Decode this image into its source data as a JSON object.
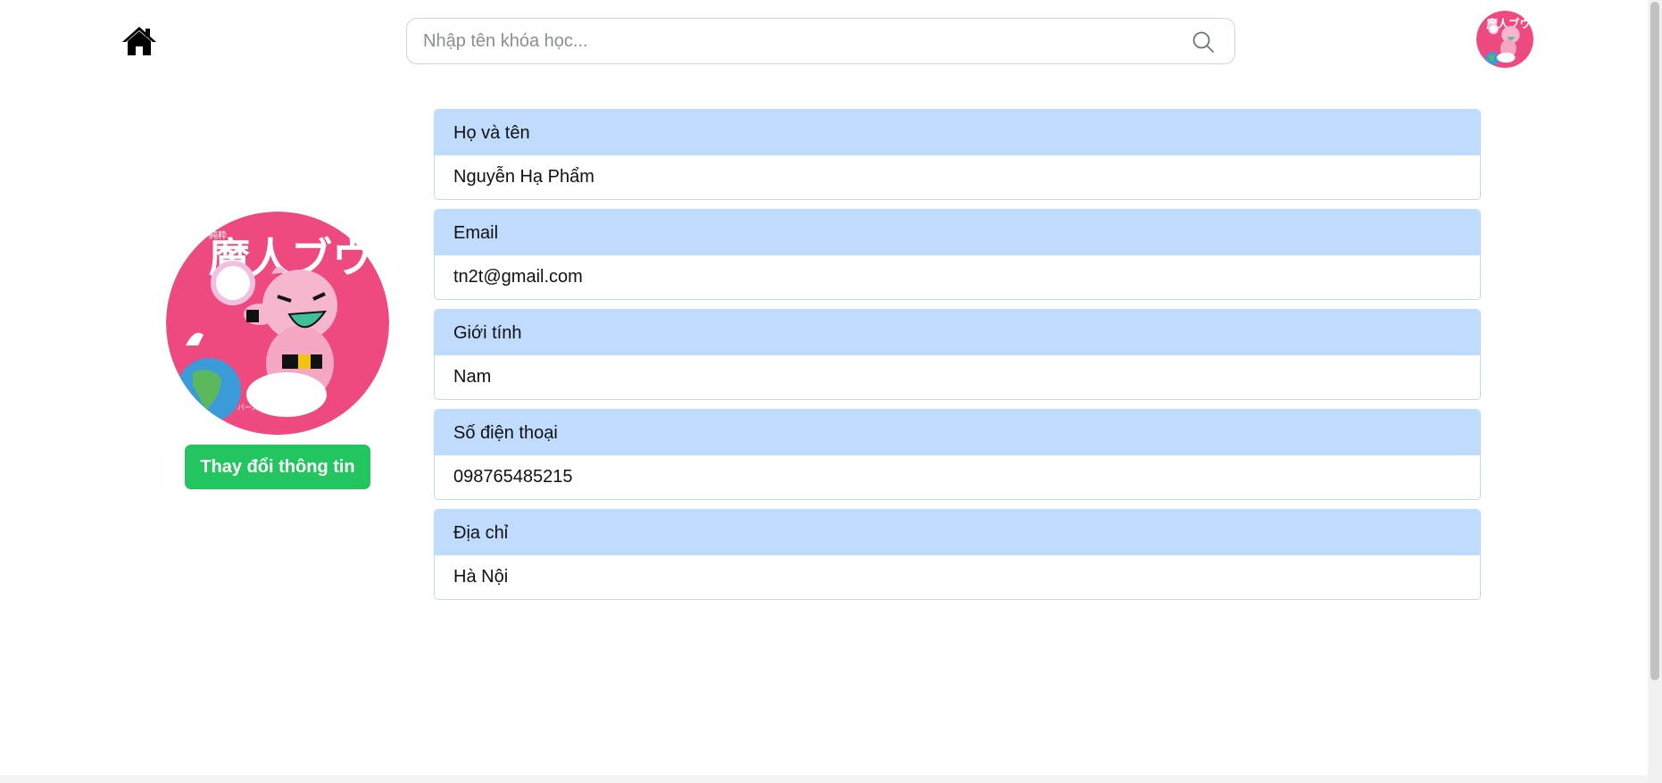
{
  "header": {
    "home_icon": "home-icon",
    "search": {
      "placeholder": "Nhập tên khóa học...",
      "value": "",
      "icon": "search-icon"
    },
    "avatar_icon": "user-avatar"
  },
  "profile": {
    "edit_button_label": "Thay đổi thông tin",
    "fields": [
      {
        "label": "Họ và tên",
        "value": "Nguyễn Hạ Phẩm"
      },
      {
        "label": "Email",
        "value": "tn2t@gmail.com"
      },
      {
        "label": "Giới tính",
        "value": "Nam"
      },
      {
        "label": "Số điện thoại",
        "value": "098765485215"
      },
      {
        "label": "Địa chỉ",
        "value": "Hà Nội"
      }
    ]
  },
  "colors": {
    "accent_green": "#22c55e",
    "card_header_bg": "#bfdbfe",
    "avatar_bg": "#ef4a80"
  }
}
